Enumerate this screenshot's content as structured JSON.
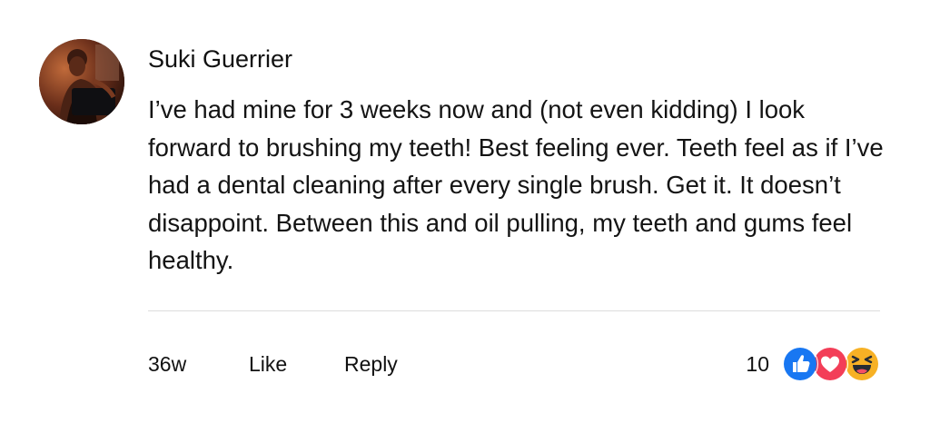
{
  "comment": {
    "author": "Suki Guerrier",
    "body": "I’ve had mine for 3 weeks now and (not even kidding) I look forward to brushing my teeth! Best feeling ever. Teeth feel as if I’ve had a dental cleaning after every single brush. Get it. It doesn’t disappoint. Between this and oil pulling, my teeth and gums feel healthy.",
    "time": "36w",
    "like_label": "Like",
    "reply_label": "Reply",
    "reaction_count": "10",
    "reactions": [
      "like-icon",
      "love-icon",
      "haha-icon"
    ],
    "colors": {
      "like": "#1877f2",
      "love": "#f33e58",
      "haha": "#f7b125"
    }
  }
}
